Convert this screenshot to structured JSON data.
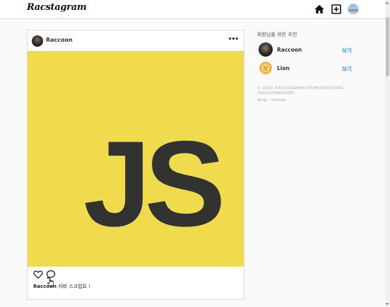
{
  "app": {
    "logo": "Racstagram"
  },
  "post": {
    "username": "Raccoon",
    "more_label": "•••",
    "image_text": "JS",
    "caption_user": "Raccoon",
    "caption_text": " 자바 스크립트 !"
  },
  "sidebar": {
    "title": "회원님을 위한 추천",
    "recommendations": [
      {
        "name": "Raccoon",
        "action": "보기"
      },
      {
        "name": "Lion",
        "action": "보기"
      }
    ],
    "footer_copy": "© 2021 RACSTAGRAM FROM TAEYOUNG (RACCOONCODE)",
    "footer_links": [
      "Blog",
      "Github"
    ],
    "footer_sep": "·"
  },
  "colors": {
    "accent": "#3897f0",
    "js_yellow": "#f0db4f",
    "js_text": "#323330"
  },
  "icons": [
    "home-icon",
    "add-post-icon",
    "profile-avatar",
    "more-icon",
    "heart-icon",
    "comment-icon"
  ]
}
